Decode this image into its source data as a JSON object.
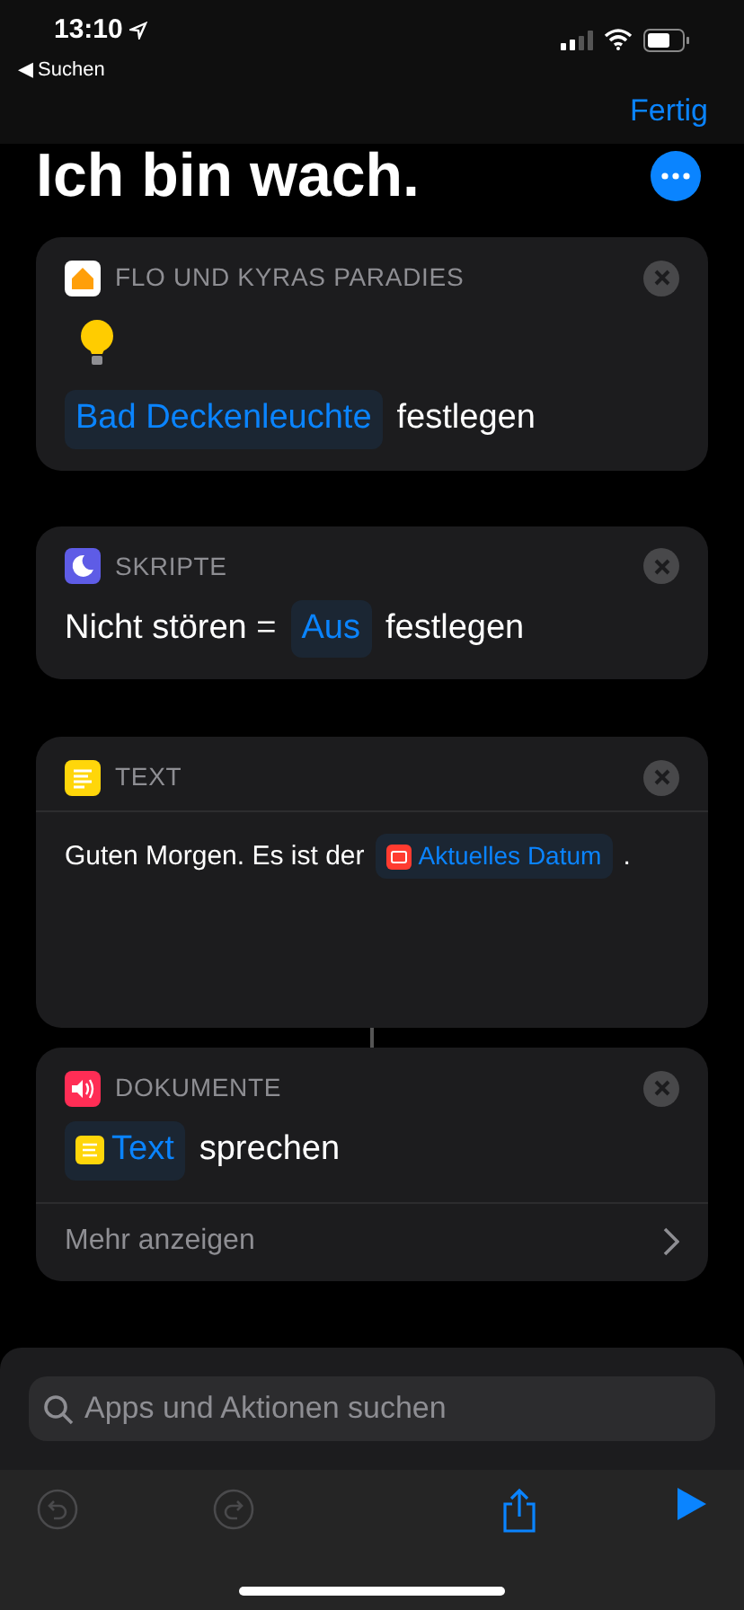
{
  "status_bar": {
    "time": "13:10",
    "back": "◀ Suchen"
  },
  "nav": {
    "done": "Fertig",
    "title": "Ich bin wach."
  },
  "actions": [
    {
      "kind": "scene",
      "app": "FLO UND KYRAS PARADIES",
      "token": "Bad Deckenleuchte",
      "suffix": "festlegen"
    },
    {
      "kind": "set",
      "app": "SKRIPTE",
      "prefix": "Nicht stören =",
      "token": "Aus",
      "suffix": "festlegen"
    },
    {
      "kind": "text",
      "app": "TEXT",
      "prefix": "Guten Morgen. Es ist der",
      "token": "Aktuelles Datum",
      "suffix": "."
    },
    {
      "kind": "speak",
      "app": "DOKUMENTE",
      "token": "Text",
      "suffix": "sprechen",
      "more": "Mehr anzeigen"
    }
  ],
  "search": {
    "placeholder": "Apps und Aktionen suchen"
  },
  "toolbar": [
    {
      "kind": "undo",
      "disabled": true
    },
    {
      "kind": "redo",
      "disabled": true
    },
    {
      "kind": "share",
      "disabled": false
    },
    {
      "kind": "run",
      "disabled": false
    }
  ]
}
